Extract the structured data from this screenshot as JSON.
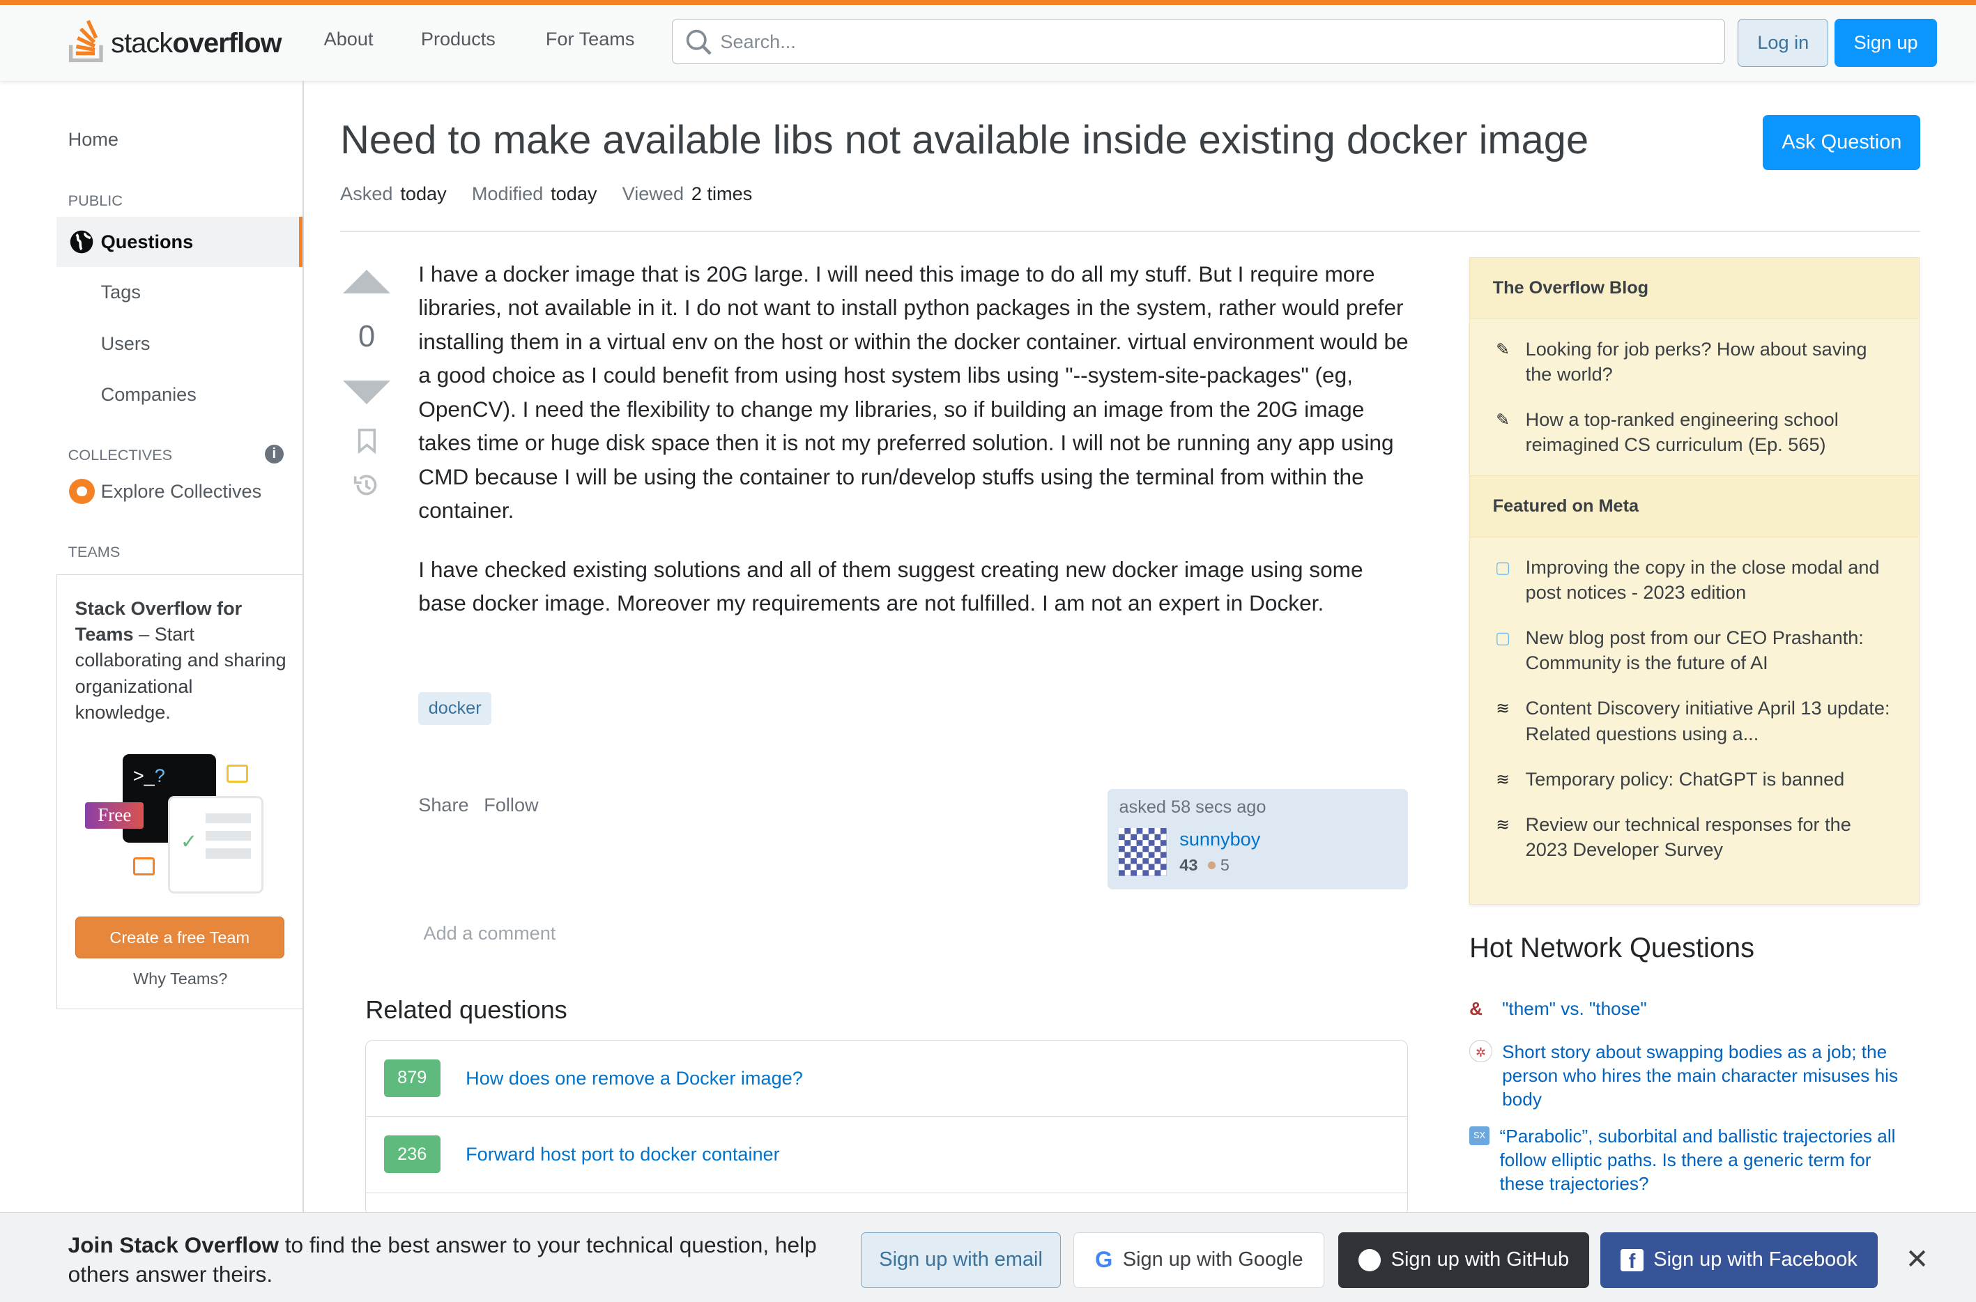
{
  "header": {
    "logo_text_light": "stack",
    "logo_text_bold": "overflow",
    "nav": [
      "About",
      "Products",
      "For Teams"
    ],
    "search_placeholder": "Search...",
    "login": "Log in",
    "signup": "Sign up"
  },
  "sidebar": {
    "home": "Home",
    "public_label": "PUBLIC",
    "questions": "Questions",
    "tags": "Tags",
    "users": "Users",
    "companies": "Companies",
    "collectives_label": "COLLECTIVES",
    "explore_collectives": "Explore Collectives",
    "teams_label": "TEAMS",
    "teams_promo_bold": "Stack Overflow for Teams",
    "teams_promo_text": " – Start collaborating and sharing organizational knowledge.",
    "free_badge": "Free",
    "create_team": "Create a free Team",
    "why_teams": "Why Teams?"
  },
  "question": {
    "title": "Need to make available libs not available inside existing docker image",
    "ask_button": "Ask Question",
    "asked_label": "Asked",
    "asked_value": "today",
    "modified_label": "Modified",
    "modified_value": "today",
    "viewed_label": "Viewed",
    "viewed_value": "2 times",
    "votes": "0",
    "body": [
      "I have a docker image that is 20G large. I will need this image to do all my stuff. But I require more libraries, not available in it. I do not want to install python packages in the system, rather would prefer installing them in a virtual env on the host or within the docker container. virtual environment would be a good choice as I could benefit from using host system libs using \"--system-site-packages\" (eg, OpenCV). I need the flexibility to change my libraries, so if building an image from the 20G image takes time or huge disk space then it is not my preferred solution. I will not be running any app using CMD because I will be using the container to run/develop stuffs using the terminal from within the container.",
      "I have checked existing solutions and all of them suggest creating new docker image using some base docker image. Moreover my requirements are not fulfilled. I am not an expert in Docker."
    ],
    "tag": "docker",
    "share": "Share",
    "follow": "Follow",
    "asked_time": "asked 58 secs ago",
    "user": "sunnyboy",
    "reputation": "43",
    "bronze": "5",
    "add_comment": "Add a comment"
  },
  "related": {
    "title": "Related questions",
    "items": [
      {
        "score": "879",
        "title": "How does one remove a Docker image?"
      },
      {
        "score": "236",
        "title": "Forward host port to docker container"
      }
    ]
  },
  "blog": {
    "heading1": "The Overflow Blog",
    "items1": [
      "Looking for job perks? How about saving the world?",
      "How a top-ranked engineering school reimagined CS curriculum (Ep. 565)"
    ],
    "heading2": "Featured on Meta",
    "items2": [
      "Improving the copy in the close modal and post notices - 2023 edition",
      "New blog post from our CEO Prashanth: Community is the future of AI",
      "Content Discovery initiative April 13 update: Related questions using a...",
      "Temporary policy: ChatGPT is banned",
      "Review our technical responses for the 2023 Developer Survey"
    ]
  },
  "hot": {
    "title": "Hot Network Questions",
    "items": [
      "\"them\" vs. \"those\"",
      "Short story about swapping bodies as a job; the person who hires the main character misuses his body",
      "“Parabolic”, suborbital and ballistic trajectories all follow elliptic paths. Is there a generic term for these trajectories?"
    ]
  },
  "footer": {
    "join_bold": "Join Stack Overflow",
    "join_text": " to find the best answer to your technical question, help others answer theirs.",
    "email": "Sign up with email",
    "google": "Sign up with Google",
    "github": "Sign up with GitHub",
    "facebook": "Sign up with Facebook"
  },
  "colors": {
    "accent": "#f48225",
    "primary": "#0a95ff",
    "blog_bg": "#fbf3d5"
  }
}
